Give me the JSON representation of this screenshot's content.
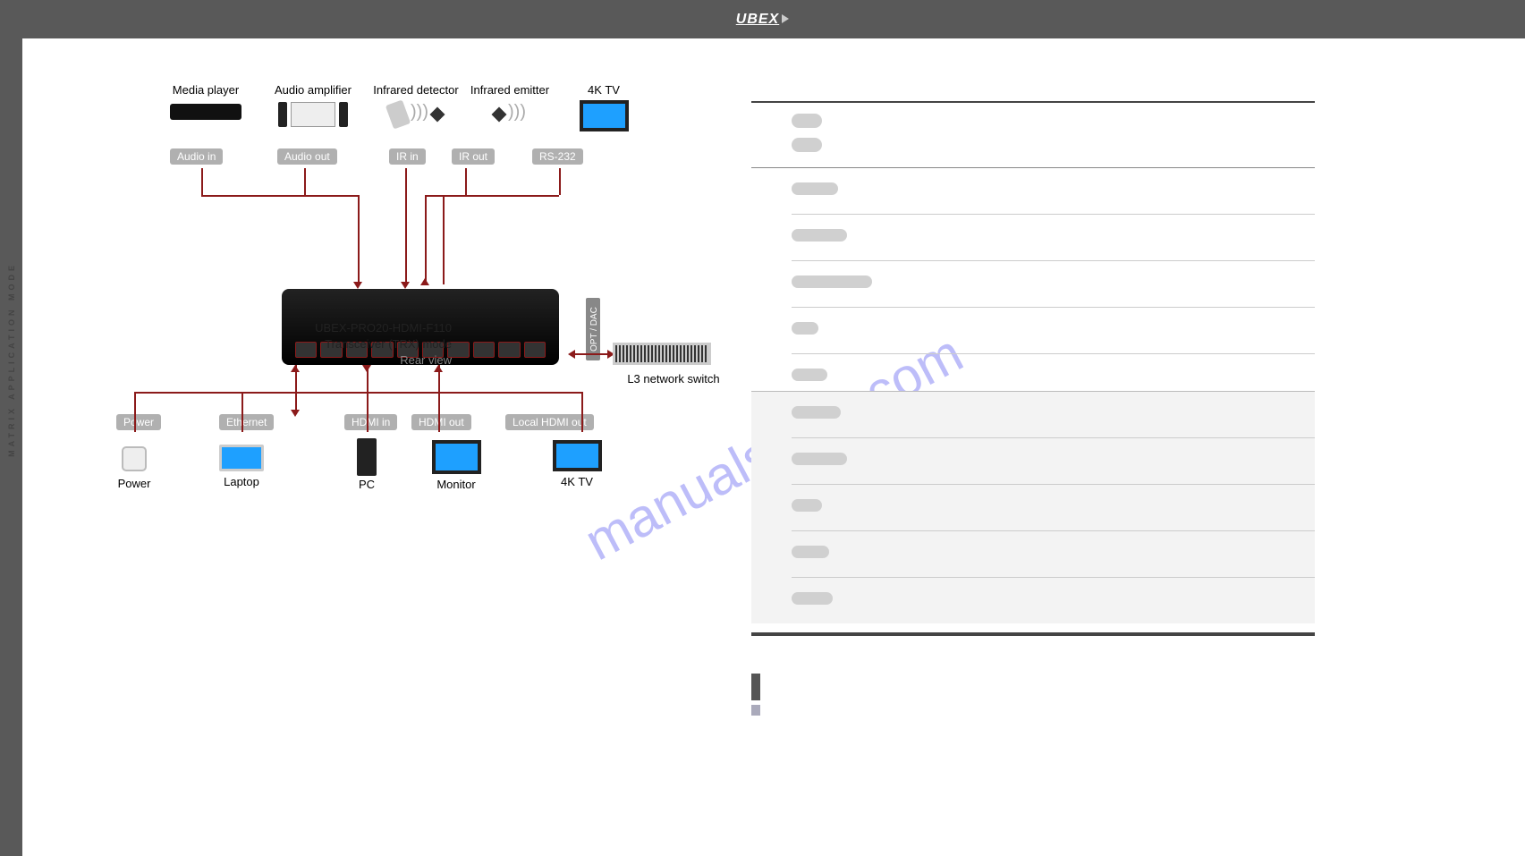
{
  "header": {
    "logo": "UBEX"
  },
  "sidebar": {
    "text": "MATRIX APPLICATION MODE"
  },
  "diagram": {
    "top": {
      "media_player": "Media player",
      "audio_amp": "Audio amplifier",
      "ir_detector": "Infrared detector",
      "ir_emitter": "Infrared emitter",
      "tv4k": "4K TV"
    },
    "tags_top": {
      "audio_in": "Audio in",
      "audio_out": "Audio out",
      "ir_in": "IR in",
      "ir_out": "IR out",
      "rs232": "RS-232"
    },
    "device": {
      "line1": "UBEX-PRO20-HDMI-F110",
      "line2": "Transceiver (TRX) mode",
      "line3": "Rear view"
    },
    "switch": "L3 network switch",
    "opt_dac": "OPT / DAC",
    "tags_bottom": {
      "power": "Power",
      "ethernet": "Ethernet",
      "hdmi_in": "HDMI in",
      "hdmi_out": "HDMI out",
      "local_hdmi": "Local HDMI out"
    },
    "bottom": {
      "power": "Power",
      "laptop": "Laptop",
      "pc": "PC",
      "monitor": "Monitor",
      "tv4k": "4K TV"
    }
  },
  "watermark": "manualshive.com",
  "toc": {
    "big_widths": [
      32,
      32
    ]
  }
}
